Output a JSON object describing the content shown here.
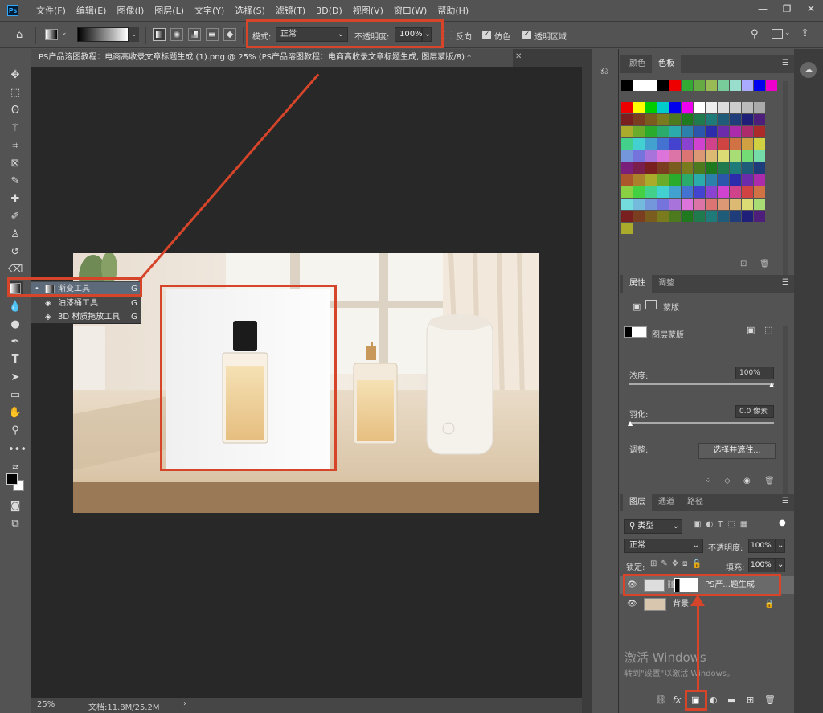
{
  "menubar": {
    "items": [
      "文件(F)",
      "编辑(E)",
      "图像(I)",
      "图层(L)",
      "文字(Y)",
      "选择(S)",
      "滤镜(T)",
      "3D(D)",
      "视图(V)",
      "窗口(W)",
      "帮助(H)"
    ],
    "app_logo": "Ps"
  },
  "options": {
    "mode_label": "模式:",
    "mode_value": "正常",
    "opacity_label": "不透明度:",
    "opacity_value": "100%",
    "reverse_label": "反向",
    "dither_label": "仿色",
    "transparency_label": "透明区域"
  },
  "document": {
    "tab_title": "PS产品溶图教程：电商高收录文章标题生成 (1).png @ 25% (PS产品溶图教程：电商高收录文章标题生成, 图层蒙版/8) *",
    "zoom": "25%",
    "doc_size": "文档:11.8M/25.2M"
  },
  "flyout": {
    "items": [
      {
        "label": "渐变工具",
        "key": "G"
      },
      {
        "label": "油漆桶工具",
        "key": "G"
      },
      {
        "label": "3D 材质拖放工具",
        "key": "G"
      }
    ]
  },
  "swatches_panel": {
    "tabs": [
      "颜色",
      "色板"
    ]
  },
  "properties_panel": {
    "tabs": [
      "属性",
      "调整"
    ],
    "section": "蒙版",
    "mask_label": "图层蒙版",
    "density_label": "浓度:",
    "density_value": "100%",
    "feather_label": "羽化:",
    "feather_value": "0.0 像素",
    "adjust_label": "调整:",
    "select_mask_button": "选择并遮住..."
  },
  "layers_panel": {
    "tabs": [
      "图层",
      "通道",
      "路径"
    ],
    "filter_kind": "类型",
    "blend_mode": "正常",
    "opacity_label": "不透明度:",
    "opacity_value": "100%",
    "lock_label": "锁定:",
    "fill_label": "填充:",
    "fill_value": "100%",
    "layers": [
      {
        "name": "PS产...题生成",
        "visible": true
      },
      {
        "name": "背景",
        "visible": true,
        "locked": true
      }
    ]
  },
  "watermark": {
    "line1": "激活 Windows",
    "line2": "转到\"设置\"以激活 Windows。"
  },
  "colors": {
    "accent_red": "#d6452a",
    "panel_bg": "#535353",
    "canvas_bg": "#282828"
  }
}
